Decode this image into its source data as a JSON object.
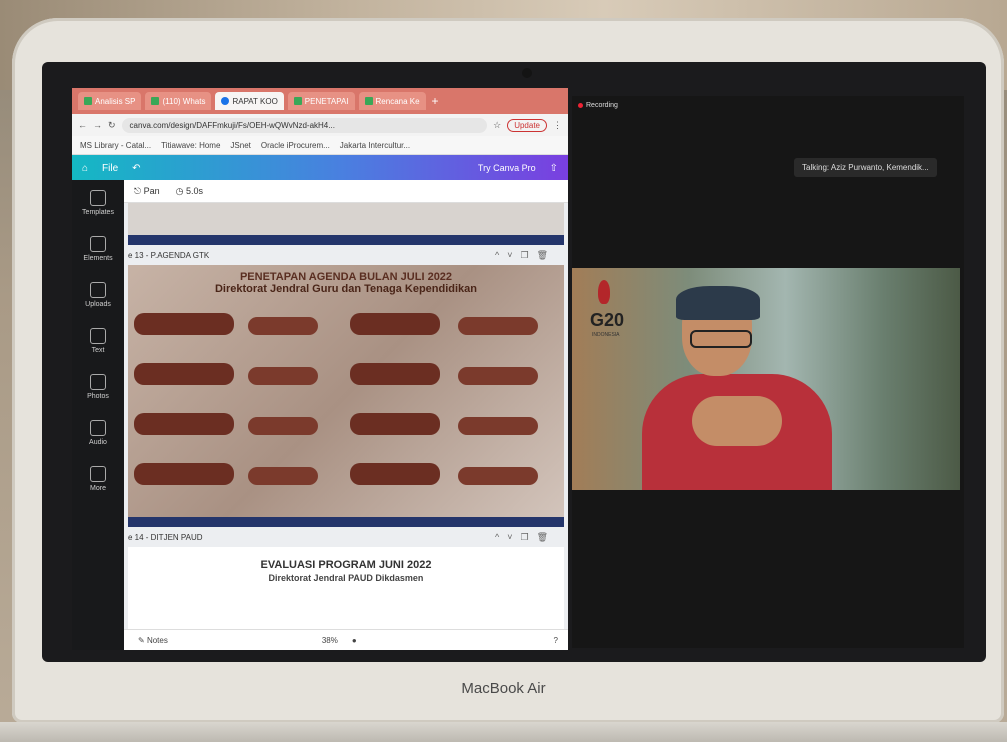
{
  "laptop": {
    "brand": "MacBook Air"
  },
  "browser": {
    "tabs": [
      {
        "label": "Analisis SP"
      },
      {
        "label": "(110) Whats"
      },
      {
        "label": "RAPAT KOO"
      },
      {
        "label": "PENETAPAI"
      },
      {
        "label": "Rencana Ke"
      }
    ],
    "new_tab": "+",
    "url": "canva.com/design/DAFFmkuji/Fs/OEH-wQWvNzd-akH4...",
    "update_label": "Update",
    "bookmarks": [
      "MS Library - Catal...",
      "Titiawave: Home",
      "JSnet",
      "Oracle iProcurem...",
      "Jakarta Intercultur..."
    ]
  },
  "canva": {
    "file_label": "File",
    "try_pro": "Try Canva Pro",
    "sidebar": [
      {
        "label": "Templates",
        "icon": "templates-icon"
      },
      {
        "label": "Elements",
        "icon": "elements-icon"
      },
      {
        "label": "Uploads",
        "icon": "uploads-icon"
      },
      {
        "label": "Text",
        "icon": "text-icon"
      },
      {
        "label": "Photos",
        "icon": "photos-icon"
      },
      {
        "label": "Audio",
        "icon": "audio-icon"
      },
      {
        "label": "More",
        "icon": "more-icon"
      }
    ],
    "tool_pan": "Pan",
    "tool_time": "5.0s",
    "page13_label": "e 13 - P.AGENDA GTK",
    "page14_label": "e 14 - DITJEN PAUD",
    "slide2": {
      "title": "PENETAPAN AGENDA BULAN JULI 2022",
      "subtitle": "Direktorat Jendral Guru dan Tenaga Kependidikan"
    },
    "slide3": {
      "title": "EVALUASI PROGRAM JUNI 2022",
      "subtitle": "Direktorat Jendral PAUD Dikdasmen"
    },
    "status": {
      "notes": "Notes",
      "zoom": "38%"
    }
  },
  "meeting": {
    "recording": "Recording",
    "talking": "Talking: Aziz Purwanto, Kemendik...",
    "g20": "G20",
    "g20_sub": "INDONESIA"
  }
}
